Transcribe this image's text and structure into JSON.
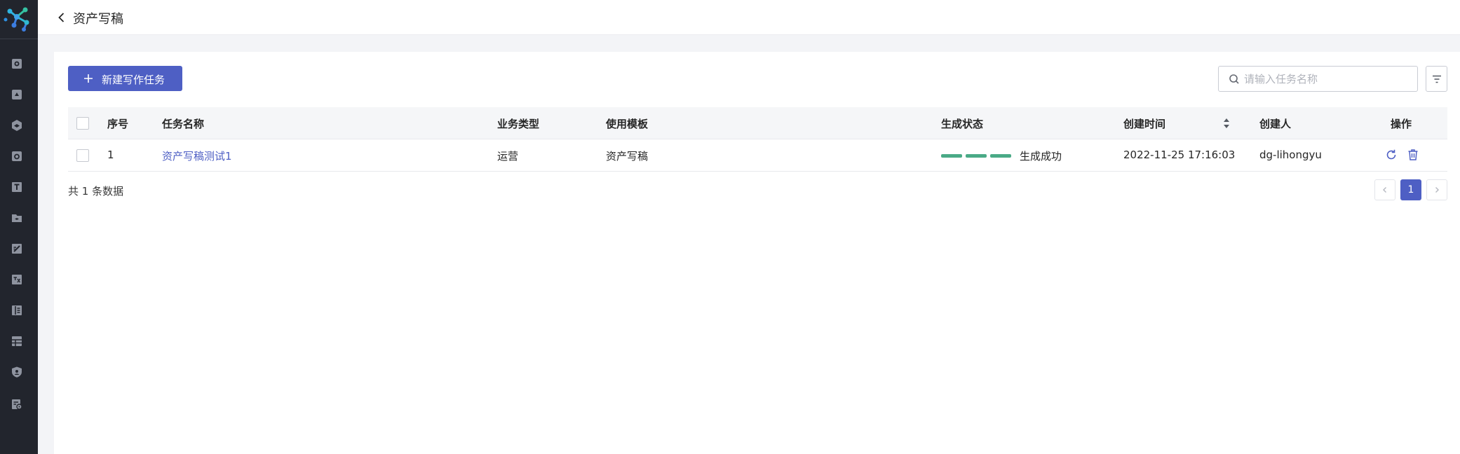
{
  "sidebar": {
    "logo_icon": "cluster-logo-icon",
    "items": [
      {
        "icon": "database-icon"
      },
      {
        "icon": "folder-icon"
      },
      {
        "icon": "cube-icon"
      },
      {
        "icon": "asset-icon"
      },
      {
        "icon": "text-icon"
      },
      {
        "icon": "layers-icon"
      },
      {
        "icon": "edit-icon"
      },
      {
        "icon": "translate-icon"
      },
      {
        "icon": "book-icon"
      },
      {
        "icon": "table-icon"
      },
      {
        "icon": "shield-icon"
      },
      {
        "icon": "settings-doc-icon"
      }
    ]
  },
  "header": {
    "title": "资产写稿"
  },
  "toolbar": {
    "new_task_label": "新建写作任务",
    "search_placeholder": "请输入任务名称",
    "search_value": ""
  },
  "table": {
    "columns": [
      "序号",
      "任务名称",
      "业务类型",
      "使用模板",
      "生成状态",
      "创建时间",
      "创建人",
      "操作"
    ],
    "rows": [
      {
        "index": "1",
        "name": "资产写稿测试1",
        "business_type": "运营",
        "template": "资产写稿",
        "status": "生成成功",
        "progress": 1.0,
        "created_at": "2022-11-25 17:16:03",
        "creator": "dg-lihongyu"
      }
    ]
  },
  "footer": {
    "total_text": "共 1 条数据",
    "current_page": "1"
  },
  "colors": {
    "primary": "#4e5fc4",
    "success": "#4aaa86",
    "sidebar_bg": "#22252d"
  }
}
